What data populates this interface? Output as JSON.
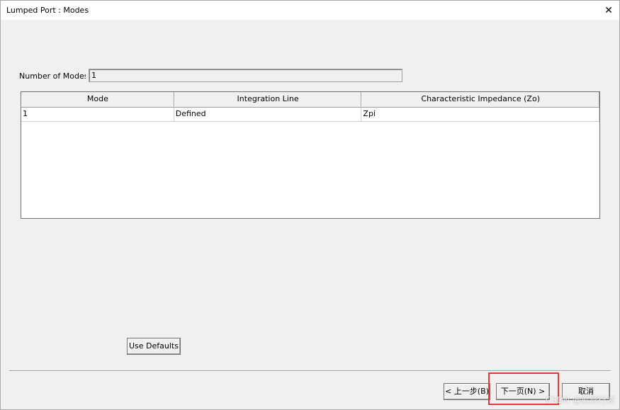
{
  "window": {
    "title": "Lumped Port : Modes",
    "close_glyph": "✕"
  },
  "modes": {
    "label": "Number of Modes",
    "value": "1"
  },
  "table": {
    "columns": [
      "Mode",
      "Integration Line",
      "Characteristic Impedance (Zo)"
    ],
    "rows": [
      [
        "1",
        "Defined",
        "Zpi"
      ]
    ]
  },
  "buttons": {
    "use_defaults": "Use Defaults",
    "back": "< 上一步(B)",
    "next": "下一页(N) >",
    "cancel": "取消"
  },
  "watermark": "CSDN @射频行波",
  "colors": {
    "highlight": "#e53935",
    "window_bg": "#f0f0f0"
  }
}
